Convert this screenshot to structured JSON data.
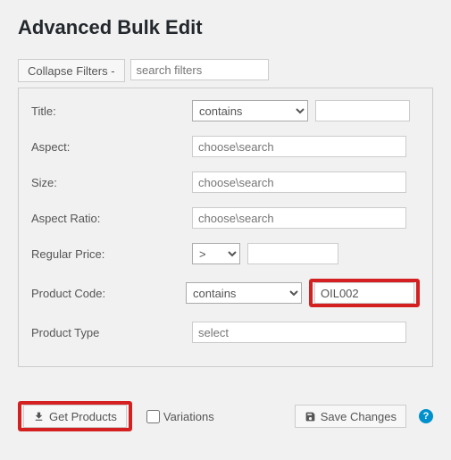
{
  "header": {
    "title": "Advanced Bulk Edit"
  },
  "top": {
    "collapse_label": "Collapse Filters -",
    "search_placeholder": "search filters"
  },
  "filters": {
    "title": {
      "label": "Title:",
      "operator": "contains",
      "value": ""
    },
    "aspect": {
      "label": "Aspect:",
      "placeholder": "choose\\search"
    },
    "size": {
      "label": "Size:",
      "placeholder": "choose\\search"
    },
    "aspect_ratio": {
      "label": "Aspect Ratio:",
      "placeholder": "choose\\search"
    },
    "regular_price": {
      "label": "Regular Price:",
      "operator": ">",
      "value": ""
    },
    "product_code": {
      "label": "Product Code:",
      "operator": "contains",
      "value": "OIL002"
    },
    "product_type": {
      "label": "Product Type",
      "placeholder": "select"
    }
  },
  "actions": {
    "get_products": "Get Products",
    "variations": "Variations",
    "save_changes": "Save Changes",
    "help": "?"
  }
}
